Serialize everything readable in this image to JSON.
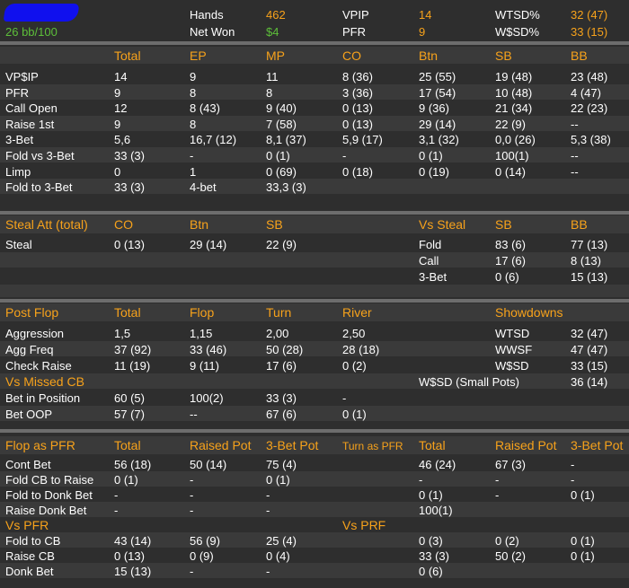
{
  "header": {
    "winrate": "26 bb/100",
    "hands_label": "Hands",
    "hands_value": "462",
    "netwon_label": "Net Won",
    "netwon_value": "$4",
    "vpip_label": "VPIP",
    "vpip_value": "14",
    "pfr_label": "PFR",
    "pfr_value": "9",
    "wtsd_label": "WTSD%",
    "wtsd_value": "32 (47)",
    "wsd_label": "W$SD%",
    "wsd_value": "33 (15)"
  },
  "preflop": {
    "columns": [
      "Total",
      "EP",
      "MP",
      "CO",
      "Btn",
      "SB",
      "BB"
    ],
    "rows": [
      [
        "VP$IP",
        "14",
        "9",
        "11",
        "8 (36)",
        "25 (55)",
        "19 (48)",
        "23 (48)"
      ],
      [
        "PFR",
        "9",
        "8",
        "8",
        "3 (36)",
        "17 (54)",
        "10 (48)",
        "4 (47)"
      ],
      [
        "Call Open",
        "12",
        "8 (43)",
        "9 (40)",
        "0 (13)",
        "9 (36)",
        "21 (34)",
        "22 (23)"
      ],
      [
        "Raise 1st",
        "9",
        "8",
        "7 (58)",
        "0 (13)",
        "29 (14)",
        "22 (9)",
        "--"
      ],
      [
        "3-Bet",
        "5,6",
        "16,7 (12)",
        "8,1 (37)",
        "5,9 (17)",
        "3,1 (32)",
        "0,0 (26)",
        "5,3 (38)"
      ],
      [
        "Fold vs 3-Bet",
        "33 (3)",
        "-",
        "0 (1)",
        "-",
        "0 (1)",
        "100(1)",
        "--"
      ],
      [
        "Limp",
        "0",
        "1",
        "0 (69)",
        "0 (18)",
        "0 (19)",
        "0 (14)",
        "--"
      ],
      [
        "Fold to 3-Bet",
        "33 (3)",
        "4-bet",
        "33,3 (3)",
        "",
        "",
        "",
        ""
      ]
    ]
  },
  "steal": {
    "title": "Steal Att (total)",
    "columns": [
      "CO",
      "Btn",
      "SB"
    ],
    "row_label": "Steal",
    "values": [
      "0 (13)",
      "29 (14)",
      "22 (9)"
    ],
    "vs_title": "Vs Steal",
    "vs_columns": [
      "SB",
      "BB"
    ],
    "vs_rows": [
      [
        "Fold",
        "83 (6)",
        "77 (13)"
      ],
      [
        "Call",
        "17 (6)",
        "8 (13)"
      ],
      [
        "3-Bet",
        "0 (6)",
        "15 (13)"
      ]
    ]
  },
  "postflop": {
    "title": "Post Flop",
    "columns": [
      "Total",
      "Flop",
      "Turn",
      "River"
    ],
    "rows": [
      [
        "Aggression",
        "1,5",
        "1,15",
        "2,00",
        "2,50"
      ],
      [
        "Agg Freq",
        "37 (92)",
        "33 (46)",
        "50 (28)",
        "28 (18)"
      ],
      [
        "Check Raise",
        "11 (19)",
        "9 (11)",
        "17 (6)",
        "0 (2)"
      ]
    ],
    "vs_missed": "Vs Missed CB",
    "missed_rows": [
      [
        "Bet in Position",
        "60 (5)",
        "100(2)",
        "33 (3)",
        "-"
      ],
      [
        "Bet OOP",
        "57 (7)",
        "--",
        "67 (6)",
        "0 (1)"
      ]
    ],
    "showdowns_title": "Showdowns",
    "showdowns": [
      [
        "WTSD",
        "32 (47)"
      ],
      [
        "WWSF",
        "47 (47)"
      ],
      [
        "W$SD",
        "33 (15)"
      ],
      [
        "W$SD (Small Pots)",
        "36 (14)"
      ]
    ]
  },
  "cbet": {
    "flop_title": "Flop as PFR",
    "flop_columns": [
      "Total",
      "Raised Pot",
      "3-Bet Pot"
    ],
    "turn_title": "Turn as PFR",
    "turn_columns": [
      "Total",
      "Raised Pot",
      "3-Bet Pot"
    ],
    "rows": [
      [
        "Cont Bet",
        "56 (18)",
        "50 (14)",
        "75 (4)",
        "46 (24)",
        "67 (3)",
        "-"
      ],
      [
        "Fold CB to Raise",
        "0 (1)",
        "-",
        "0 (1)",
        "-",
        "-",
        "-"
      ],
      [
        "Fold to Donk Bet",
        "-",
        "-",
        "-",
        "0 (1)",
        "-",
        "0 (1)"
      ],
      [
        "Raise Donk Bet",
        "-",
        "-",
        "-",
        "100(1)",
        "",
        ""
      ]
    ],
    "vs_pfr_title": "Vs PFR",
    "vs_prf_title": "Vs PRF",
    "vs_rows": [
      [
        "Fold to CB",
        "43 (14)",
        "56 (9)",
        "25 (4)",
        "0 (3)",
        "0 (2)",
        "0 (1)"
      ],
      [
        "Raise CB",
        "0 (13)",
        "0 (9)",
        "0 (4)",
        "33 (3)",
        "50 (2)",
        "0 (1)"
      ],
      [
        "Donk Bet",
        "15 (13)",
        "-",
        "-",
        "0 (6)",
        "",
        ""
      ]
    ]
  },
  "colors": {
    "background": "#2e2e2e",
    "stripe": "#3a3a3a",
    "separator": "#6d6d6d",
    "header_orange": "#f7a21b",
    "green": "#5dbf3a",
    "text": "#ffffff",
    "redaction_blue": "#1010ee"
  }
}
